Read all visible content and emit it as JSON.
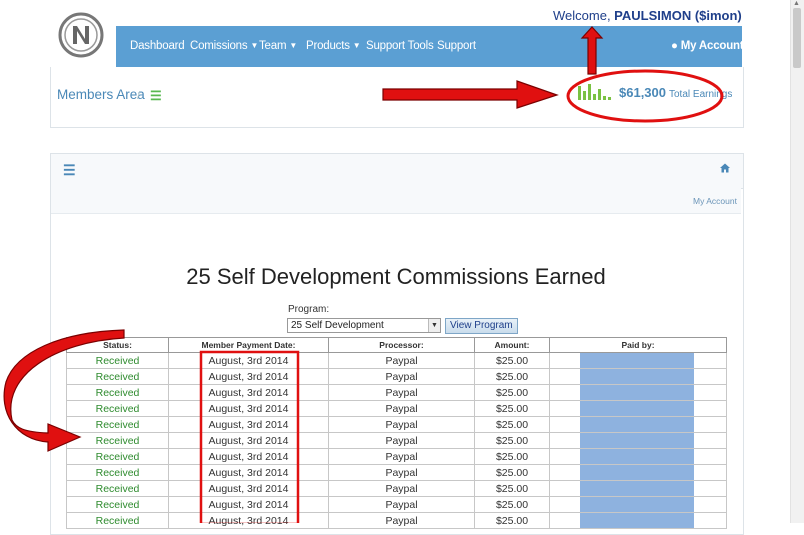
{
  "header": {
    "welcome_prefix": "Welcome, ",
    "welcome_user": "PAULSIMON ($imon)",
    "nav": [
      {
        "label": "Dashboard",
        "caret": false
      },
      {
        "label": "Comissions",
        "caret": true
      },
      {
        "label": "Team",
        "caret": true
      },
      {
        "label": "Products",
        "caret": true
      },
      {
        "label": "Support Tools",
        "caret": false
      },
      {
        "label": "Support",
        "caret": false
      }
    ],
    "account_label": "My Account",
    "breadcrumb": "Members Area",
    "earnings_amount": "$61,300",
    "earnings_label": "Total Earnings"
  },
  "panel": {
    "my_account_link": "My Account",
    "title": "25 Self Development Commissions Earned",
    "program_label": "Program:",
    "program_selected": "25 Self Development",
    "view_button": "View Program"
  },
  "table": {
    "headers": [
      "Status:",
      "Member Payment Date:",
      "Processor:",
      "Amount:",
      "Paid by:"
    ],
    "rows": [
      [
        "Received",
        "August, 3rd 2014",
        "Paypal",
        "$25.00"
      ],
      [
        "Received",
        "August, 3rd 2014",
        "Paypal",
        "$25.00"
      ],
      [
        "Received",
        "August, 3rd 2014",
        "Paypal",
        "$25.00"
      ],
      [
        "Received",
        "August, 3rd 2014",
        "Paypal",
        "$25.00"
      ],
      [
        "Received",
        "August, 3rd 2014",
        "Paypal",
        "$25.00"
      ],
      [
        "Received",
        "August, 3rd 2014",
        "Paypal",
        "$25.00"
      ],
      [
        "Received",
        "August, 3rd 2014",
        "Paypal",
        "$25.00"
      ],
      [
        "Received",
        "August, 3rd 2014",
        "Paypal",
        "$25.00"
      ],
      [
        "Received",
        "August, 3rd 2014",
        "Paypal",
        "$25.00"
      ],
      [
        "Received",
        "August, 3rd 2014",
        "Paypal",
        "$25.00"
      ],
      [
        "Received",
        "August, 3rd 2014",
        "Paypal",
        "$25.00"
      ]
    ]
  },
  "colors": {
    "navbar": "#5b9fd3",
    "status_green": "#2e8b2e",
    "paid_by_fill": "#8eb2df",
    "annotation_red": "#e01010",
    "link_blue": "#4a88b7"
  },
  "icons": {
    "logo": "n-circle-logo",
    "breadcrumb_menu": "list-icon",
    "panel_menu": "list-icon",
    "home": "home-icon",
    "account": "user-icon",
    "earnings": "sparkline-icon"
  }
}
